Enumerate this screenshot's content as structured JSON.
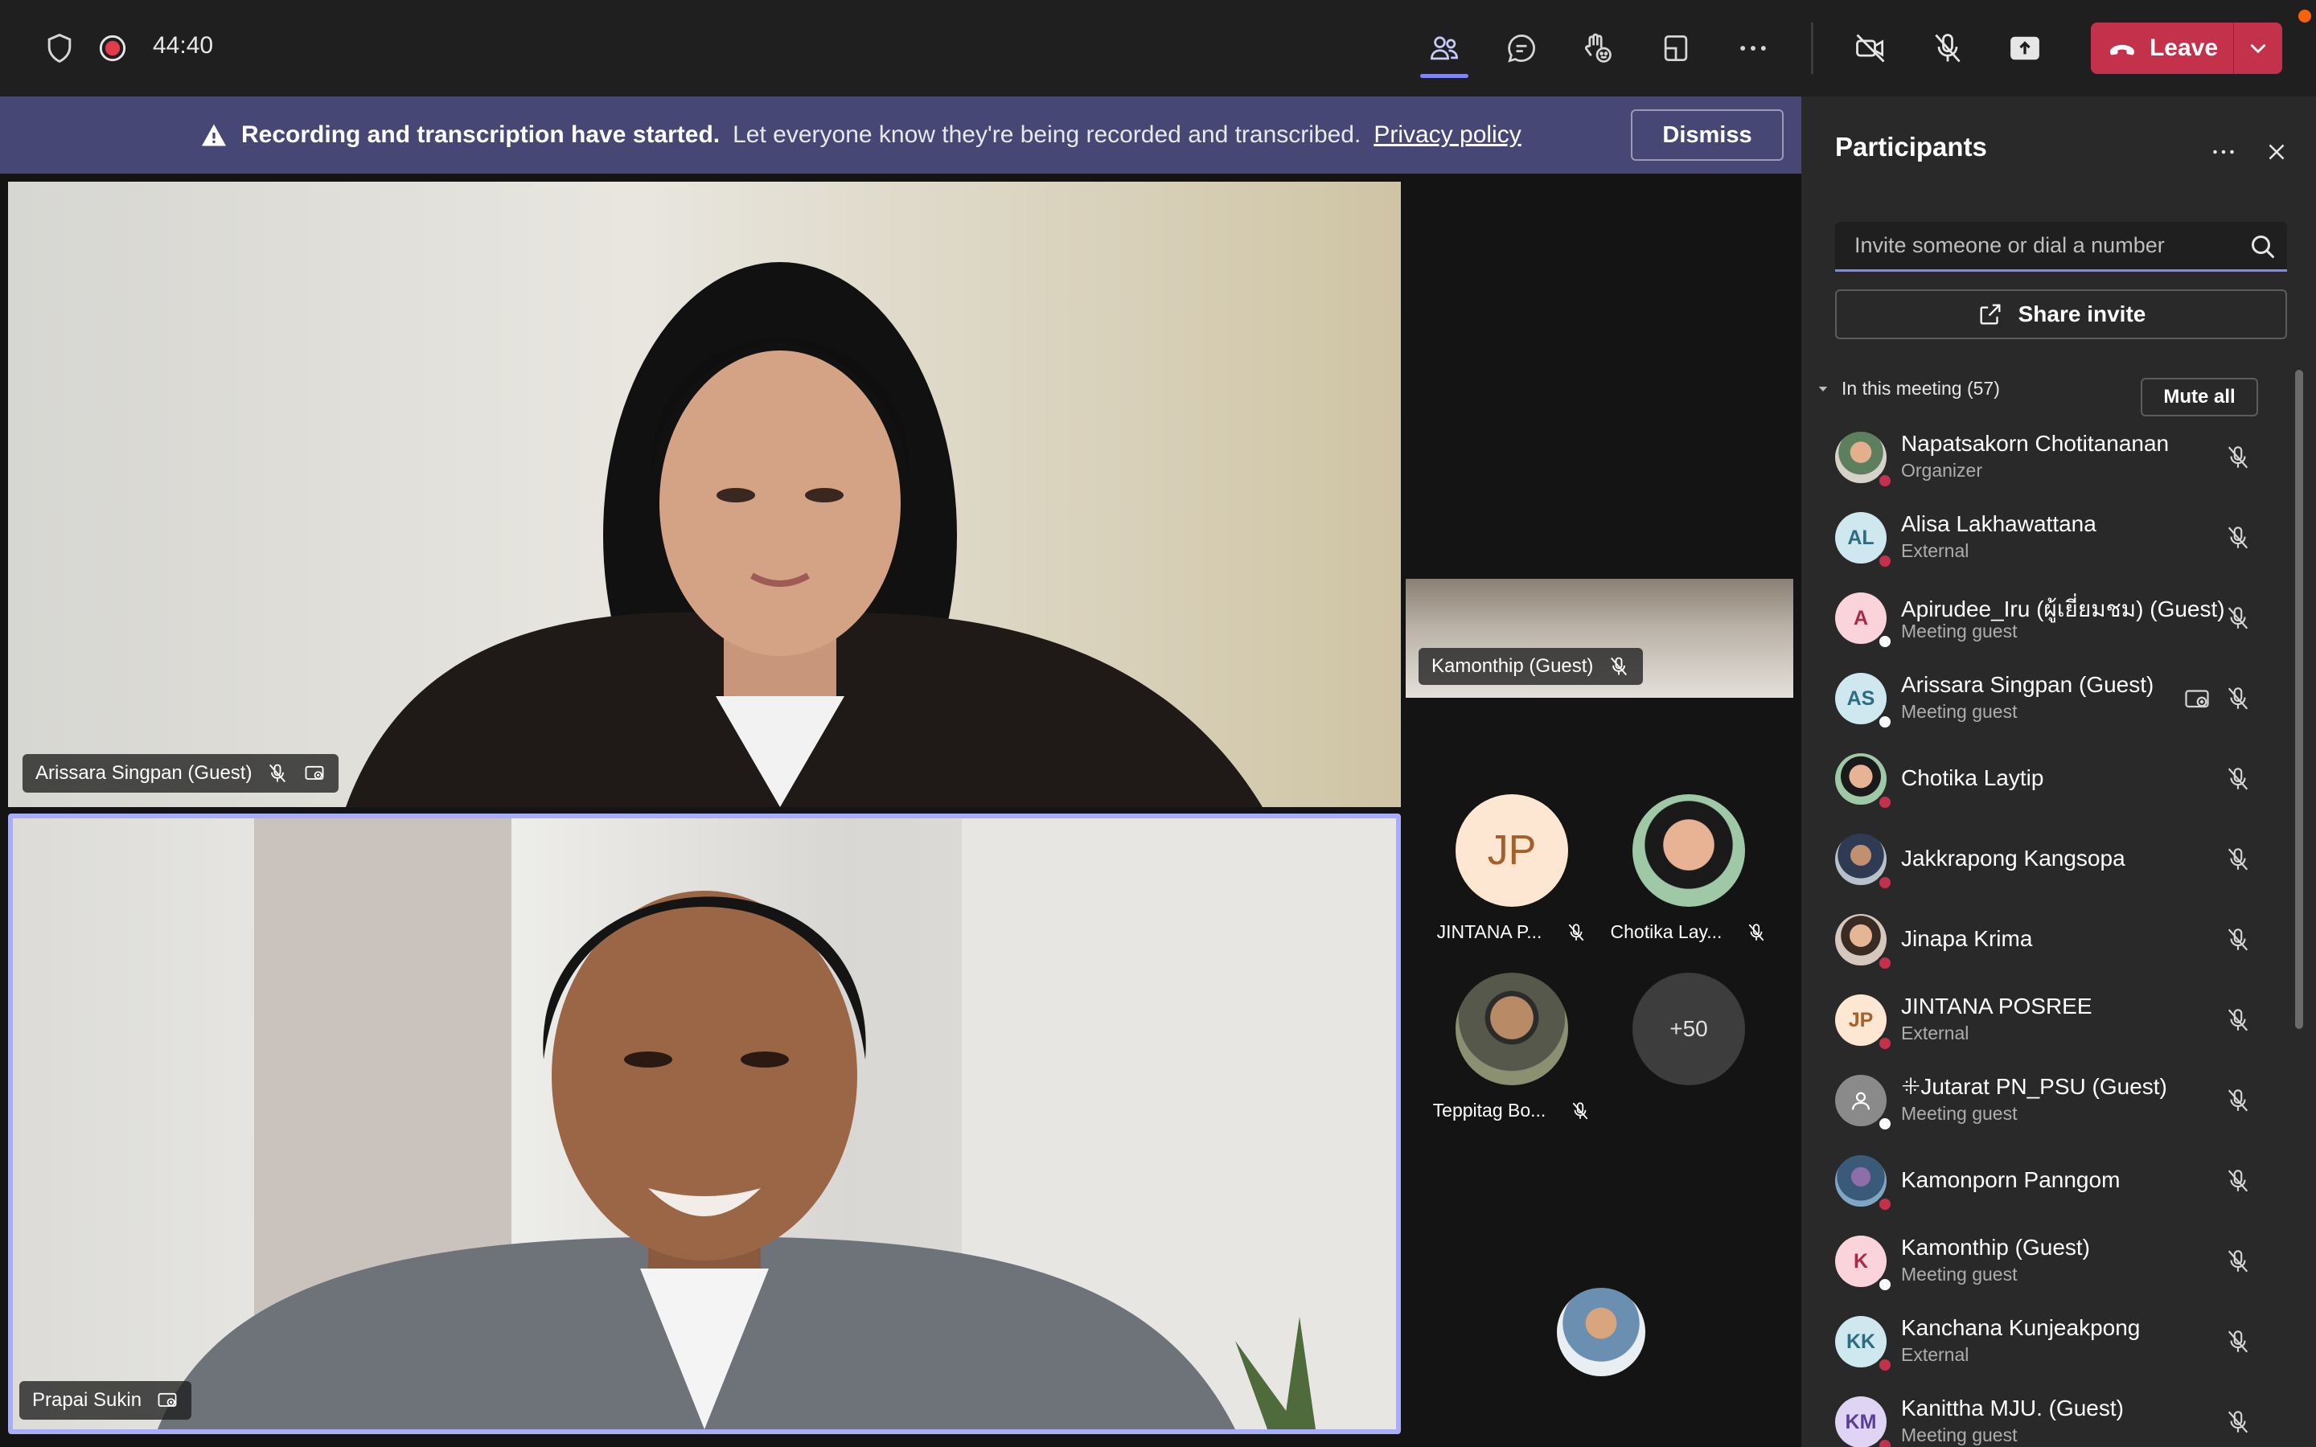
{
  "toolbar": {
    "timer": "44:40",
    "leave_label": "Leave"
  },
  "banner": {
    "title": "Recording and transcription have started.",
    "message": "Let everyone know they're being recorded and transcribed.",
    "link": "Privacy policy",
    "dismiss_label": "Dismiss"
  },
  "stage": {
    "main_tiles": [
      {
        "name": "Arissara Singpan (Guest)"
      },
      {
        "name": "Prapai Sukin"
      }
    ],
    "side_tile": {
      "name": "Kamonthip (Guest)"
    },
    "gallery": [
      {
        "name": "JINTANA P...",
        "initials": "JP"
      },
      {
        "name": "Chotika Lay..."
      },
      {
        "name": "Teppitag Bo..."
      }
    ],
    "overflow_count": "+50"
  },
  "panel": {
    "title": "Participants",
    "invite_placeholder": "Invite someone or dial a number",
    "share_invite_label": "Share invite",
    "meeting_header": "In this meeting (57)",
    "mute_all_label": "Mute all",
    "participants": [
      {
        "name": "Napatsakorn Chotitananan",
        "role": "Organizer",
        "initials": ""
      },
      {
        "name": "Alisa Lakhawattana",
        "role": "External",
        "initials": "AL"
      },
      {
        "name": "Apirudee_Iru (ผู้เยี่ยมชม) (Guest)",
        "role": "Meeting guest",
        "initials": "A"
      },
      {
        "name": "Arissara Singpan (Guest)",
        "role": "Meeting guest",
        "initials": "AS"
      },
      {
        "name": "Chotika Laytip",
        "role": "",
        "initials": ""
      },
      {
        "name": "Jakkrapong Kangsopa",
        "role": "",
        "initials": ""
      },
      {
        "name": "Jinapa Krima",
        "role": "",
        "initials": ""
      },
      {
        "name": "JINTANA POSREE",
        "role": "External",
        "initials": "JP"
      },
      {
        "name": "ꔰJutarat PN_PSU (Guest)",
        "role": "Meeting guest",
        "initials": ""
      },
      {
        "name": "Kamonporn Panngom",
        "role": "",
        "initials": ""
      },
      {
        "name": "Kamonthip (Guest)",
        "role": "Meeting guest",
        "initials": "K"
      },
      {
        "name": "Kanchana Kunjeakpong",
        "role": "External",
        "initials": "KK"
      },
      {
        "name": "Kanittha MJU. (Guest)",
        "role": "Meeting guest",
        "initials": "KM"
      }
    ]
  },
  "colors": {
    "accent": "#7f85f5",
    "leave": "#c4314b",
    "banner": "#464775",
    "status_busy": "#c4314b",
    "status_offline": "#ffffff"
  }
}
